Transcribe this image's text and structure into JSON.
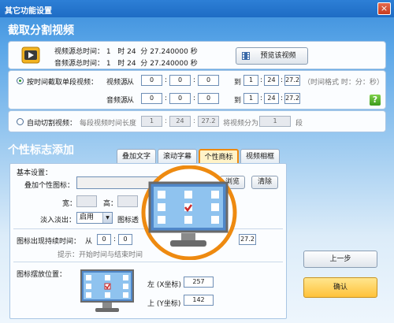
{
  "window": {
    "title": "其它功能设置",
    "close_glyph": "×"
  },
  "section1": {
    "title": "截取分割视频",
    "video_total_label": "视频源总时间：",
    "audio_total_label": "音频源总时间：",
    "video_total": {
      "h": "1",
      "h_unit": "时",
      "m": "24",
      "m_unit": "分",
      "s": "27.240000",
      "s_unit": "秒"
    },
    "audio_total": {
      "h": "1",
      "h_unit": "时",
      "m": "24",
      "m_unit": "分",
      "s": "27.240000",
      "s_unit": "秒"
    },
    "preview_button": "预览该视频",
    "option_time": {
      "label": "按时间截取单段视频：",
      "video_label": "视频源",
      "audio_label": "音频源",
      "from": "从",
      "to": "到",
      "video_from": [
        "0",
        "0",
        "0"
      ],
      "video_to": [
        "1",
        "24",
        "27.2"
      ],
      "audio_from": [
        "0",
        "0",
        "0"
      ],
      "audio_to": [
        "1",
        "24",
        "27.2"
      ],
      "sep": ":",
      "format_hint": "（时间格式 时：分：秒）",
      "help_glyph": "?"
    },
    "option_auto": {
      "label": "自动切割视频：",
      "segment_label": "每段视频时间长度",
      "segment": [
        "1",
        "24",
        "27.2"
      ],
      "split_label": "将视频分为",
      "split_value": "1",
      "split_unit": "段"
    }
  },
  "section2": {
    "title": "个性标志添加",
    "tabs": [
      "叠加文字",
      "滚动字幕",
      "个性商标",
      "视频相框"
    ],
    "active_tab": 2,
    "basic_label": "基本设置：",
    "overlay_icon_label": "叠加个性图标：",
    "browse_button": "浏览",
    "clear_button": "清除",
    "width_label": "宽：",
    "height_label": "高：",
    "fade_label": "淡入淡出：",
    "fade_value": "启用",
    "icon_trans_label": "图标透",
    "appear_label": "图标出现持续时间：",
    "appear_from": "从",
    "appear_values": [
      "0",
      "0"
    ],
    "appear_end": "27.2",
    "appear_hint": "提示：开始时间与结束时间",
    "position_label": "图标摆放位置：",
    "left_label": "左 (X坐标)",
    "left_value": "257",
    "top_label": "上 (Y坐标)",
    "top_value": "142"
  },
  "actions": {
    "prev_button": "上一步",
    "ok_button": "确认"
  },
  "colors": {
    "accent_orange": "#ee8a10",
    "title_blue": "#2d7fd6",
    "ok_yellow": "#ffd35a",
    "checkbox_red": "#cc2a2a"
  }
}
